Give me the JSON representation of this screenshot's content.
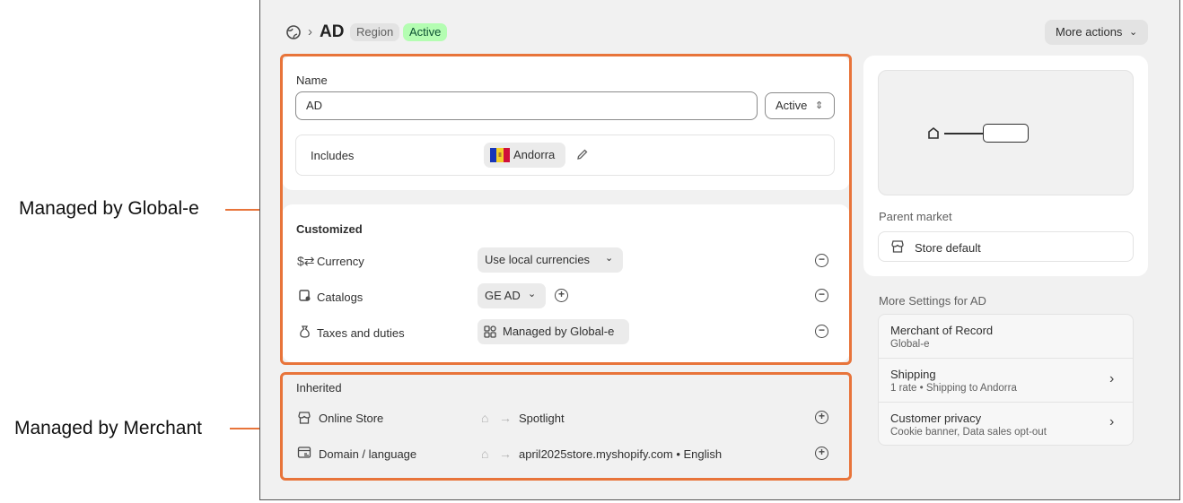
{
  "annotations": {
    "global_e": "Managed by Global-e",
    "merchant": "Managed by Merchant"
  },
  "header": {
    "breadcrumb_sep": "›",
    "title": "AD",
    "badge_region": "Region",
    "badge_active": "Active",
    "more_actions": "More actions"
  },
  "name_card": {
    "name_label": "Name",
    "name_value": "AD",
    "status_value": "Active",
    "includes_label": "Includes",
    "country": "Andorra"
  },
  "customized": {
    "title": "Customized",
    "rows": [
      {
        "label": "Currency",
        "value": "Use local currencies"
      },
      {
        "label": "Catalogs",
        "value": "GE AD"
      },
      {
        "label": "Taxes and duties",
        "value": "Managed by Global-e"
      }
    ]
  },
  "inherited": {
    "title": "Inherited",
    "rows": [
      {
        "label": "Online Store",
        "value": "Spotlight"
      },
      {
        "label": "Domain / language",
        "value": "april2025store.myshopify.com • English"
      }
    ]
  },
  "side": {
    "parent_market_label": "Parent market",
    "parent_market_value": "Store default",
    "more_settings_title": "More Settings for AD",
    "settings": [
      {
        "title": "Merchant of Record",
        "sub": "Global-e"
      },
      {
        "title": "Shipping",
        "sub": "1 rate • Shipping to Andorra"
      },
      {
        "title": "Customer privacy",
        "sub": "Cookie banner, Data sales opt-out"
      }
    ]
  },
  "colors": {
    "accent_outline": "#e8743a",
    "badge_active_bg": "#b4fdb2",
    "badge_active_text": "#0c5132",
    "page_bg": "#f1f1f1"
  },
  "icons": [
    "globe-icon",
    "chevron-down-icon",
    "updown-chevron-icon",
    "andorra-flag-icon",
    "pencil-icon",
    "currency-icon",
    "catalog-icon",
    "taxes-icon",
    "app-icon",
    "minus-circle-icon",
    "plus-circle-icon",
    "store-icon",
    "domain-icon",
    "arrow-right-icon",
    "home-icon",
    "chevron-right-icon"
  ]
}
